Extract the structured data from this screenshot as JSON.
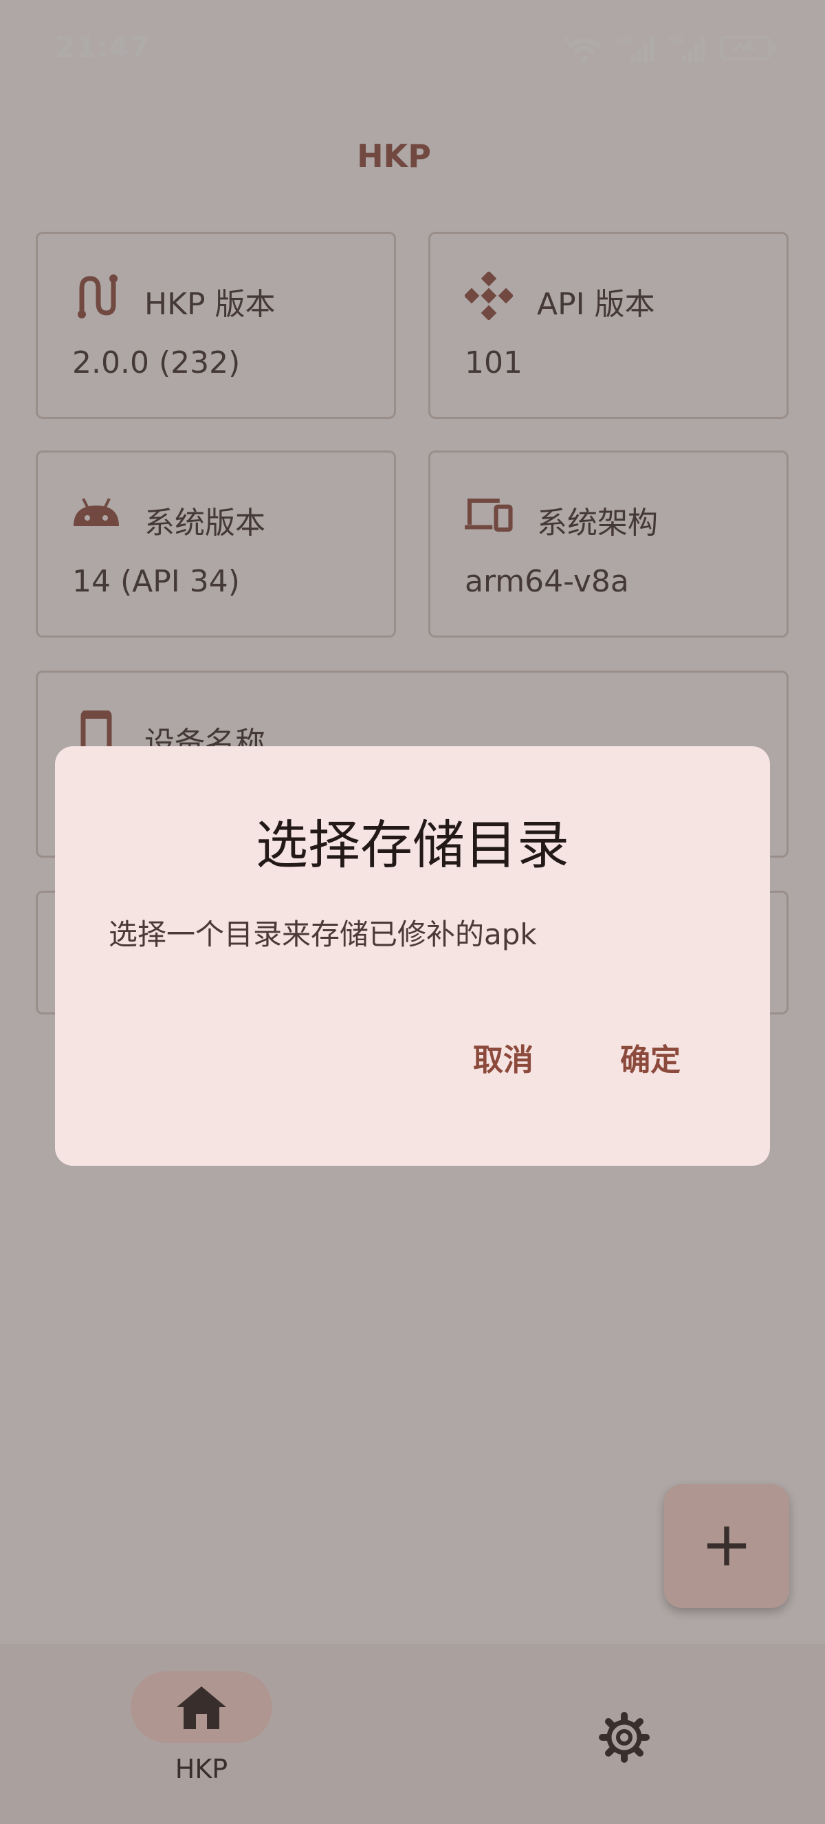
{
  "status_bar": {
    "time": "21:47",
    "net_labels": [
      "6",
      "4G",
      "5G"
    ]
  },
  "app_bar": {
    "title": "HKP"
  },
  "cards": [
    {
      "icon": "route-icon",
      "label": "HKP 版本",
      "value": "2.0.0 (232)"
    },
    {
      "icon": "api-diamond-icon",
      "label": "API 版本",
      "value": "101"
    },
    {
      "icon": "android-icon",
      "label": "系统版本",
      "value": "14 (API 34)"
    },
    {
      "icon": "devices-icon",
      "label": "系统架构",
      "value": "arm64-v8a"
    },
    {
      "icon": "smartphone-icon",
      "label": "设备名称",
      "value": ""
    }
  ],
  "fab": {
    "icon": "plus-icon",
    "glyph": "+"
  },
  "bottom_nav": {
    "items": [
      {
        "icon": "home-icon",
        "label": "HKP",
        "selected": true
      },
      {
        "icon": "settings-icon",
        "label": "",
        "selected": false
      }
    ]
  },
  "dialog": {
    "title": "选择存储目录",
    "message": "选择一个目录来存储已修补的apk",
    "cancel_label": "取消",
    "confirm_label": "确定"
  },
  "colors": {
    "primary": "#8c4a3c",
    "surface": "#fdf8f6",
    "dialog_surface": "#f6e4e2",
    "pill": "#ffd9d0",
    "card_border": "#d8cac6"
  }
}
